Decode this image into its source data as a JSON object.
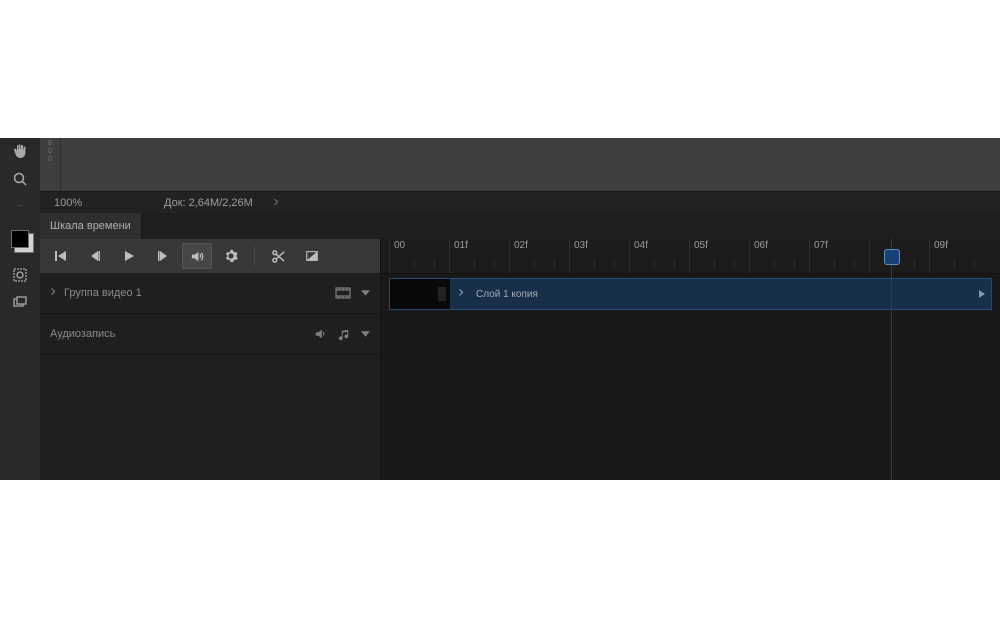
{
  "statusbar": {
    "zoom": "100%",
    "doc": "Док: 2,64M/2,26M"
  },
  "panel": {
    "tab_label": "Шкала времени"
  },
  "ruler_ticks": [
    "00",
    "01f",
    "02f",
    "03f",
    "04f",
    "05f",
    "06f",
    "07f",
    "",
    "09f"
  ],
  "tracks": {
    "group_label": "Группа видео 1",
    "audio_label": "Аудиозапись"
  },
  "clip": {
    "label": "Слой 1 копия"
  },
  "vruler": {
    "t1": "8",
    "t2": "0",
    "t3": "0"
  },
  "tools": {
    "hand": "hand-icon",
    "zoom": "zoom-icon",
    "more": "more-icon",
    "swatch": "swatch-icon",
    "quickmask": "quickmask-icon",
    "screens": "screens-icon"
  },
  "transport": {
    "first": "go-to-first-frame",
    "prev": "previous-frame",
    "play": "play",
    "next": "next-frame",
    "audio": "mute-audio",
    "settings": "settings",
    "split": "split-at-playhead",
    "transition": "transition"
  },
  "track_row_icons": {
    "filmstrip": "filmstrip-icon",
    "menu": "menu-icon",
    "speaker": "speaker-icon",
    "note": "music-note-icon"
  }
}
